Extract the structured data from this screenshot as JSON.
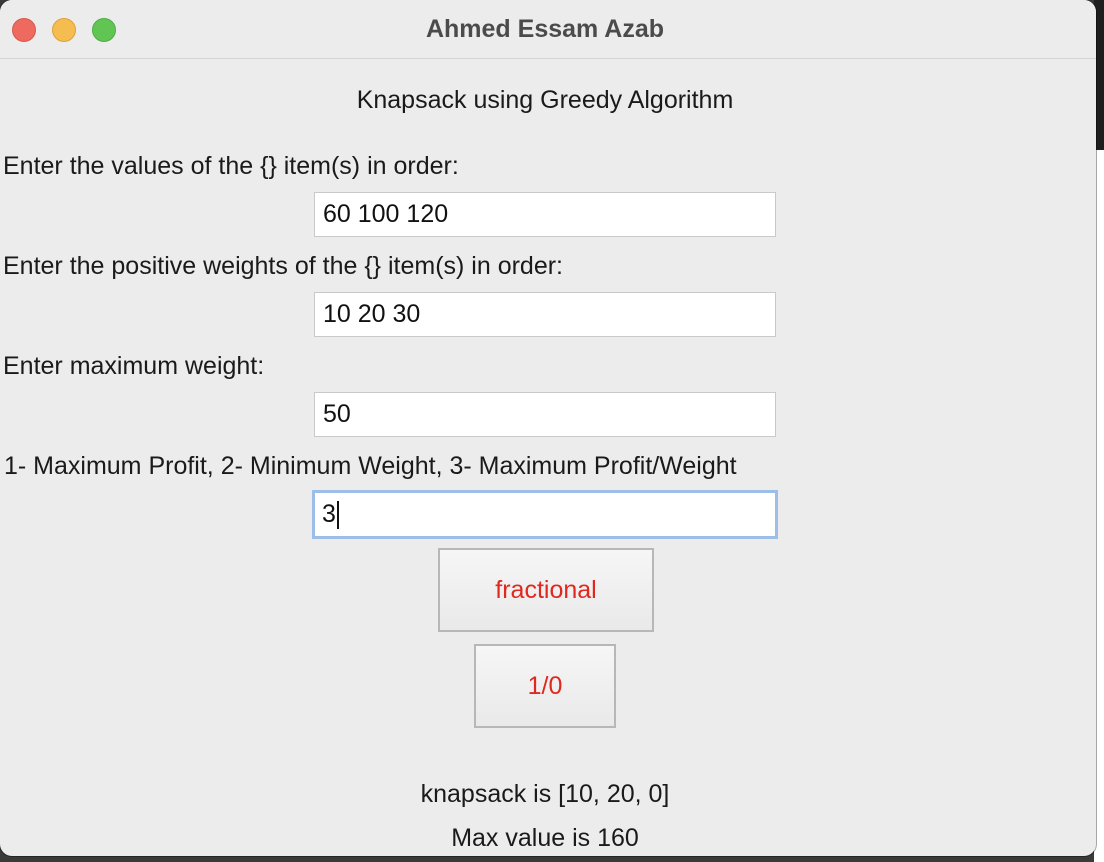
{
  "window": {
    "title": "Ahmed Essam Azab"
  },
  "main": {
    "heading": "Knapsack using Greedy Algorithm",
    "values_label": "Enter the values of the {} item(s) in order:",
    "values_input": "60 100 120",
    "weights_label": "Enter the positive weights of the {} item(s) in order:",
    "weights_input": "10 20 30",
    "max_weight_label": "Enter maximum weight:",
    "max_weight_input": "50",
    "strategy_label": "1- Maximum Profit, 2- Minimum Weight, 3- Maximum Profit/Weight",
    "strategy_input": "3",
    "fractional_button": "fractional",
    "zero_one_button": "1/0",
    "knapsack_result": "knapsack is  [10, 20, 0]",
    "max_value_result": "Max value is 160"
  },
  "colors": {
    "button_text": "#e0281e",
    "focus_ring": "#9cbee8",
    "window_bg": "#ececec"
  }
}
